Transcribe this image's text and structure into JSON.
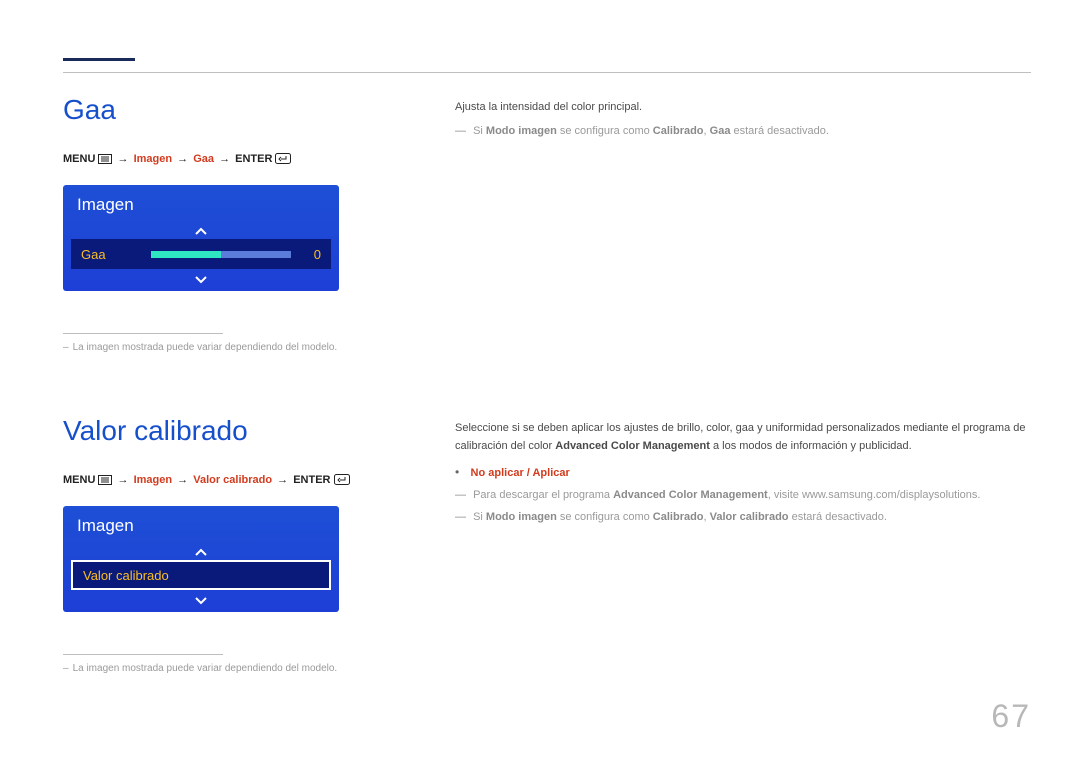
{
  "page_number": "67",
  "gaa": {
    "heading": "Gaa",
    "path": {
      "menu": "MENU",
      "p1": "Imagen",
      "p2": "Gaa",
      "enter": "ENTER"
    },
    "panel": {
      "title": "Imagen",
      "row_label": "Gaa",
      "row_value": "0"
    },
    "footnote": "La imagen mostrada puede variar dependiendo del modelo.",
    "body_line1": "Ajusta la intensidad del color principal.",
    "note": {
      "pre": "Si ",
      "b1": "Modo imagen",
      "mid": " se configura como ",
      "b2": "Calibrado",
      "post1": ", ",
      "b3": "Gaa",
      "post2": " estará desactivado."
    }
  },
  "vc": {
    "heading": "Valor calibrado",
    "path": {
      "menu": "MENU",
      "p1": "Imagen",
      "p2": "Valor calibrado",
      "enter": "ENTER"
    },
    "panel": {
      "title": "Imagen",
      "row_label": "Valor calibrado"
    },
    "footnote": "La imagen mostrada puede variar dependiendo del modelo.",
    "body": {
      "para1a": "Seleccione si se deben aplicar los ajustes de brillo, color, gaa y uniformidad personalizados mediante el programa de calibración del color ",
      "para1b": "Advanced Color Management",
      "para1c": " a los modos de información y publicidad.",
      "opts": "No aplicar / Aplicar"
    },
    "note1": {
      "pre": "Para descargar el programa ",
      "b1": "Advanced Color Management",
      "post": ", visite www.samsung.com/displaysolutions."
    },
    "note2": {
      "pre": "Si ",
      "b1": "Modo imagen",
      "mid": " se configura como ",
      "b2": "Calibrado",
      "post1": ", ",
      "b3": "Valor calibrado",
      "post2": " estará desactivado."
    }
  }
}
